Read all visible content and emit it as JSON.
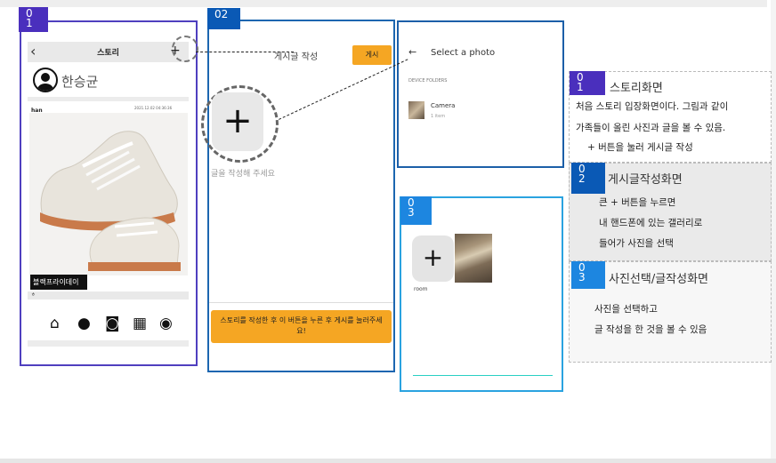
{
  "frame1": {
    "number": "0\n1",
    "header_title": "스토리",
    "user_name": "한승균",
    "post_user": "han",
    "post_date": "2021.12.02 04:36:36",
    "caption": "블랙프라이데이",
    "comment_text": "ㅎ"
  },
  "frame2": {
    "number": "02",
    "write_title": "게시글 작성",
    "post_button": "게시",
    "write_hint": "글을 작성해 주세요",
    "guide_button": "스토리를 작성한 후 이 버튼을 누른 후 게시를 눌러주세요!"
  },
  "photo_picker": {
    "title": "Select a photo",
    "section": "DEVICE FOLDERS",
    "folder_name": "Camera",
    "folder_count": "1 item"
  },
  "frame3": {
    "number": "0\n3",
    "room_label": "room"
  },
  "notes": [
    {
      "number": "0\n1",
      "title": "스토리화면",
      "lines": [
        "처음 스토리 입장화면이다. 그림과 같이",
        "가족들이 올린 사진과 글을 볼 수 있음.",
        "+ 버튼을 눌러 게시글 작성"
      ]
    },
    {
      "number": "0\n2",
      "title": "게시글작성화면",
      "lines": [
        "큰 + 버튼을 누르면",
        "내 핸드폰에 있는 갤러리로",
        "들어가 사진을 선택"
      ]
    },
    {
      "number": "0\n3",
      "title": "사진선택/글작성화면",
      "lines": [
        "사진을 선택하고",
        "글 작성을 한 것을 볼 수 있음"
      ]
    }
  ],
  "colors": {
    "frame1": "#4f3fbf",
    "frame2": "#1c66b0",
    "frame3": "#2aa3e0",
    "accent_button": "#f5a623"
  }
}
